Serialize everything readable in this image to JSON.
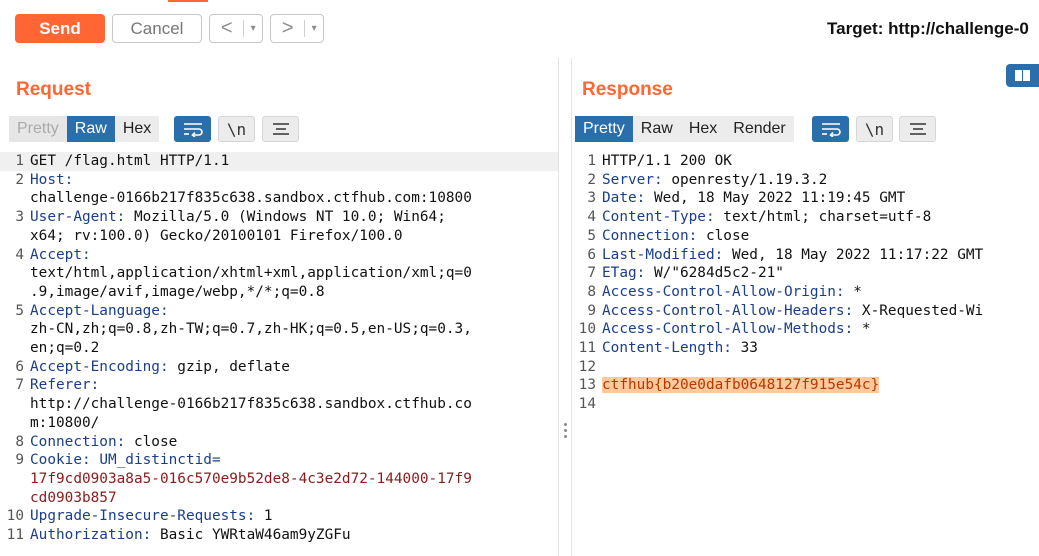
{
  "toolbar": {
    "send_label": "Send",
    "cancel_label": "Cancel",
    "prev_glyph": "<",
    "next_glyph": ">",
    "dropdown_glyph": "▾",
    "target_text": "Target: http://challenge-0"
  },
  "request": {
    "title": "Request",
    "tabs": [
      {
        "label": "Pretty",
        "state": "disabled"
      },
      {
        "label": "Raw",
        "state": "active"
      },
      {
        "label": "Hex",
        "state": "normal"
      }
    ],
    "newline_glyph": "\\n",
    "lines": [
      {
        "num": "1",
        "segments": [
          {
            "t": "GET /flag.html HTTP/1.1",
            "k": "val"
          }
        ],
        "current": true
      },
      {
        "num": "2",
        "segments": [
          {
            "t": "Host:",
            "k": "hdr"
          }
        ]
      },
      {
        "num": "",
        "segments": [
          {
            "t": "challenge-0166b217f835c638.sandbox.ctfhub.com:10800",
            "k": "val"
          }
        ]
      },
      {
        "num": "3",
        "segments": [
          {
            "t": "User-Agent:",
            "k": "hdr"
          },
          {
            "t": " Mozilla/5.0 (Windows NT 10.0; Win64;",
            "k": "val"
          }
        ]
      },
      {
        "num": "",
        "segments": [
          {
            "t": "x64; rv:100.0) Gecko/20100101 Firefox/100.0",
            "k": "val"
          }
        ]
      },
      {
        "num": "4",
        "segments": [
          {
            "t": "Accept:",
            "k": "hdr"
          }
        ]
      },
      {
        "num": "",
        "segments": [
          {
            "t": "text/html,application/xhtml+xml,application/xml;q=0",
            "k": "val"
          }
        ]
      },
      {
        "num": "",
        "segments": [
          {
            "t": ".9,image/avif,image/webp,*/*;q=0.8",
            "k": "val"
          }
        ]
      },
      {
        "num": "5",
        "segments": [
          {
            "t": "Accept-Language:",
            "k": "hdr"
          }
        ]
      },
      {
        "num": "",
        "segments": [
          {
            "t": "zh-CN,zh;q=0.8,zh-TW;q=0.7,zh-HK;q=0.5,en-US;q=0.3,",
            "k": "val"
          }
        ]
      },
      {
        "num": "",
        "segments": [
          {
            "t": "en;q=0.2",
            "k": "val"
          }
        ]
      },
      {
        "num": "6",
        "segments": [
          {
            "t": "Accept-Encoding:",
            "k": "hdr"
          },
          {
            "t": " gzip, deflate",
            "k": "val"
          }
        ]
      },
      {
        "num": "7",
        "segments": [
          {
            "t": "Referer:",
            "k": "hdr"
          }
        ]
      },
      {
        "num": "",
        "segments": [
          {
            "t": "http://challenge-0166b217f835c638.sandbox.ctfhub.co",
            "k": "val"
          }
        ]
      },
      {
        "num": "",
        "segments": [
          {
            "t": "m:10800/",
            "k": "val"
          }
        ]
      },
      {
        "num": "8",
        "segments": [
          {
            "t": "Connection:",
            "k": "hdr"
          },
          {
            "t": " close",
            "k": "val"
          }
        ]
      },
      {
        "num": "9",
        "segments": [
          {
            "t": "Cookie:",
            "k": "hdr"
          },
          {
            "t": " UM_distinctid=",
            "k": "hdr"
          }
        ]
      },
      {
        "num": "",
        "segments": [
          {
            "t": "17f9cd0903a8a5-016c570e9b52de8-4c3e2d72-144000-17f9",
            "k": "cookie"
          }
        ]
      },
      {
        "num": "",
        "segments": [
          {
            "t": "cd0903b857",
            "k": "cookie"
          }
        ]
      },
      {
        "num": "10",
        "segments": [
          {
            "t": "Upgrade-Insecure-Requests:",
            "k": "hdr"
          },
          {
            "t": " 1",
            "k": "val"
          }
        ]
      },
      {
        "num": "11",
        "segments": [
          {
            "t": "Authorization:",
            "k": "hdr"
          },
          {
            "t": " Basic YWRtaW46am9yZGFu",
            "k": "val"
          }
        ]
      }
    ]
  },
  "response": {
    "title": "Response",
    "tabs": [
      {
        "label": "Pretty",
        "state": "active"
      },
      {
        "label": "Raw",
        "state": "normal"
      },
      {
        "label": "Hex",
        "state": "normal"
      },
      {
        "label": "Render",
        "state": "normal"
      }
    ],
    "newline_glyph": "\\n",
    "lines": [
      {
        "num": "1",
        "segments": [
          {
            "t": "HTTP/1.1 200 OK",
            "k": "val"
          }
        ]
      },
      {
        "num": "2",
        "segments": [
          {
            "t": "Server:",
            "k": "hdr"
          },
          {
            "t": " openresty/1.19.3.2",
            "k": "val"
          }
        ]
      },
      {
        "num": "3",
        "segments": [
          {
            "t": "Date:",
            "k": "hdr"
          },
          {
            "t": " Wed, 18 May 2022 11:19:45 GMT",
            "k": "val"
          }
        ]
      },
      {
        "num": "4",
        "segments": [
          {
            "t": "Content-Type:",
            "k": "hdr"
          },
          {
            "t": " text/html; charset=utf-8",
            "k": "val"
          }
        ]
      },
      {
        "num": "5",
        "segments": [
          {
            "t": "Connection:",
            "k": "hdr"
          },
          {
            "t": " close",
            "k": "val"
          }
        ]
      },
      {
        "num": "6",
        "segments": [
          {
            "t": "Last-Modified:",
            "k": "hdr"
          },
          {
            "t": " Wed, 18 May 2022 11:17:22 GMT",
            "k": "val"
          }
        ]
      },
      {
        "num": "7",
        "segments": [
          {
            "t": "ETag:",
            "k": "hdr"
          },
          {
            "t": " W/\"6284d5c2-21\"",
            "k": "val"
          }
        ]
      },
      {
        "num": "8",
        "segments": [
          {
            "t": "Access-Control-Allow-Origin:",
            "k": "hdr"
          },
          {
            "t": " *",
            "k": "val"
          }
        ]
      },
      {
        "num": "9",
        "segments": [
          {
            "t": "Access-Control-Allow-Headers:",
            "k": "hdr"
          },
          {
            "t": " X-Requested-Wi",
            "k": "val"
          }
        ]
      },
      {
        "num": "10",
        "segments": [
          {
            "t": "Access-Control-Allow-Methods:",
            "k": "hdr"
          },
          {
            "t": " *",
            "k": "val"
          }
        ]
      },
      {
        "num": "11",
        "segments": [
          {
            "t": "Content-Length:",
            "k": "hdr"
          },
          {
            "t": " 33",
            "k": "val"
          }
        ]
      },
      {
        "num": "12",
        "segments": [
          {
            "t": "",
            "k": "val"
          }
        ]
      },
      {
        "num": "13",
        "segments": [
          {
            "t": "ctfhub{b20e0dafb0648127f915e54c}",
            "k": "flag"
          }
        ]
      },
      {
        "num": "14",
        "segments": [
          {
            "t": "",
            "k": "val"
          }
        ]
      }
    ]
  },
  "colors": {
    "accent": "#ff6633",
    "active_tab": "#2a6eab",
    "header_name": "#1a3e8c",
    "cookie_value": "#8b1b1b",
    "flag_highlight": "#ffc99e"
  }
}
